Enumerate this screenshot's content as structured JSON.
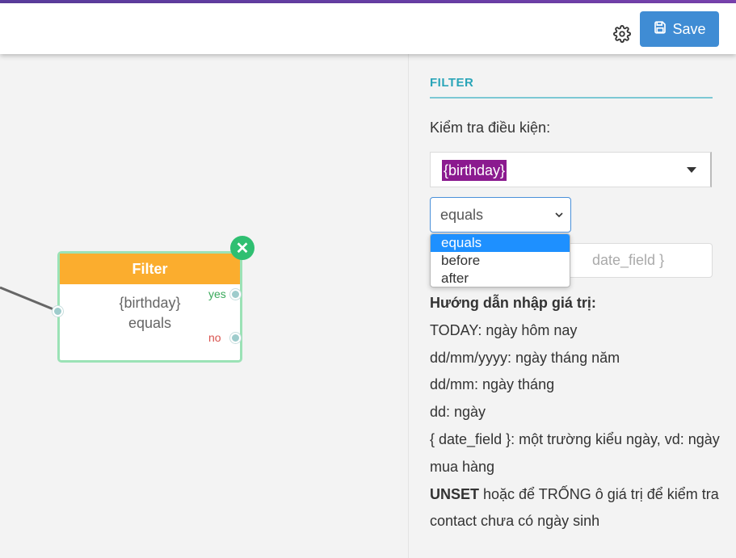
{
  "header": {
    "save_label": "Save",
    "settings_icon": "gear-icon",
    "save_icon": "floppy-disk-icon"
  },
  "colors": {
    "accent": "#5b3d9e",
    "save_button": "#3f8cd4",
    "node_header": "#fbad2e",
    "node_border": "#9be2b6",
    "close_button": "#2fbf71",
    "panel_title": "#2aa5b8",
    "tag_bg": "#8b1a8f"
  },
  "node": {
    "title": "Filter",
    "field": "{birthday}",
    "operator": "equals",
    "yes_label": "yes",
    "no_label": "no",
    "close_icon": "close-icon"
  },
  "panel": {
    "title": "FILTER",
    "condition_label": "Kiểm tra điều kiện:",
    "field_tag": "{birthday}",
    "operator_value": "equals",
    "operator_options": [
      "equals",
      "before",
      "after"
    ],
    "value_placeholder": "date_field }",
    "guide": {
      "title": "Hướng dẫn nhập giá trị:",
      "line1": "TODAY: ngày hôm nay",
      "line2": "dd/mm/yyyy: ngày tháng năm",
      "line3": "dd/mm: ngày tháng",
      "line4": "dd: ngày",
      "line5": "{ date_field }: một trường kiểu ngày, vd: ngày mua hàng",
      "line6_bold": "UNSET",
      "line6_rest": " hoặc để TRỐNG ô giá trị để kiểm tra contact chưa có ngày sinh"
    }
  }
}
